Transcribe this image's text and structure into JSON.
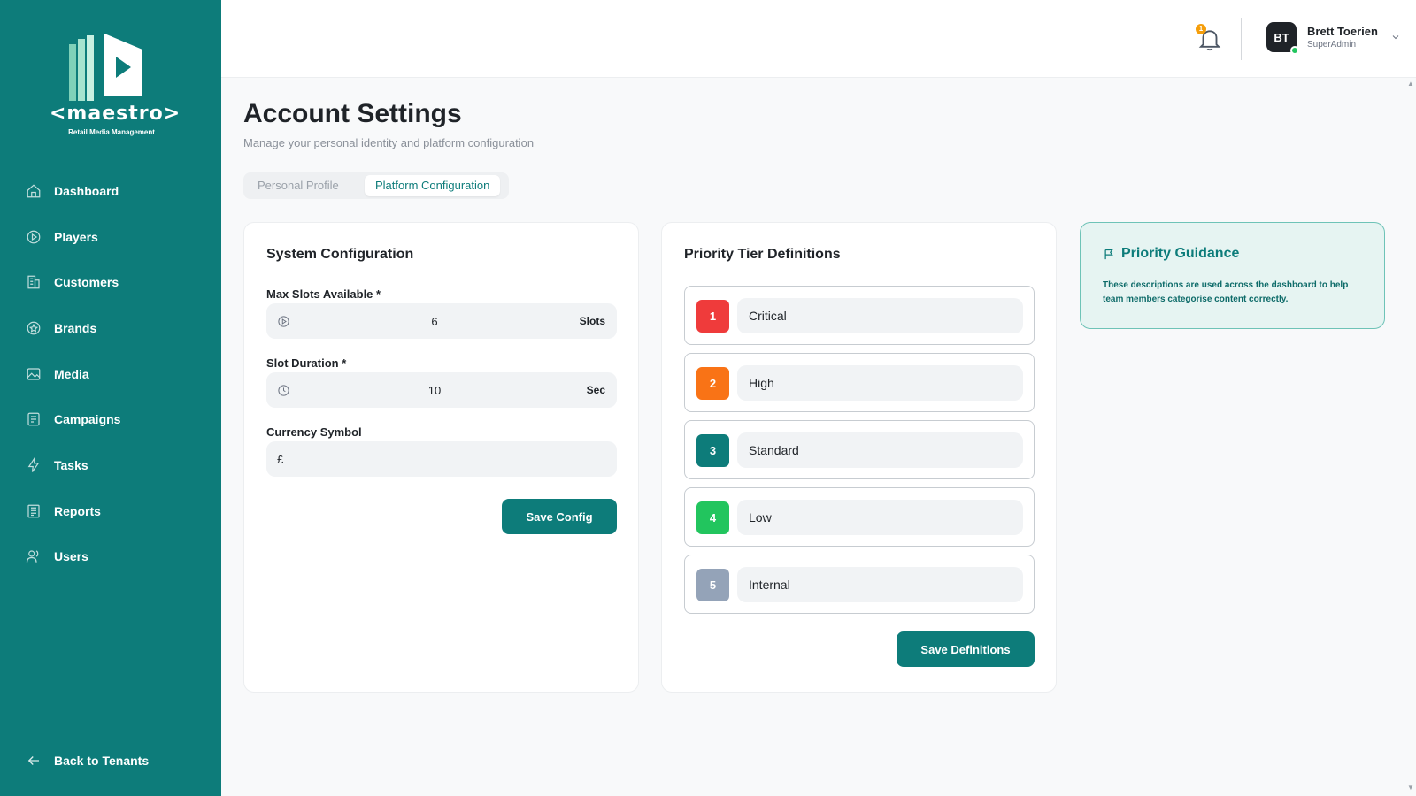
{
  "brand": {
    "name": "<maestro>",
    "tagline": "Retail Media Management",
    "sidebar_color": "#0d7c7a"
  },
  "sidebar": {
    "items": [
      {
        "label": "Dashboard",
        "icon": "home-icon"
      },
      {
        "label": "Players",
        "icon": "play-circle-icon"
      },
      {
        "label": "Customers",
        "icon": "building-icon"
      },
      {
        "label": "Brands",
        "icon": "star-icon"
      },
      {
        "label": "Media",
        "icon": "image-icon"
      },
      {
        "label": "Campaigns",
        "icon": "campaign-icon"
      },
      {
        "label": "Tasks",
        "icon": "lightning-icon"
      },
      {
        "label": "Reports",
        "icon": "report-icon"
      },
      {
        "label": "Users",
        "icon": "users-icon"
      }
    ],
    "back_label": "Back to Tenants"
  },
  "header": {
    "notifications_count": "1",
    "user": {
      "initials": "BT",
      "name": "Brett Toerien",
      "role": "SuperAdmin"
    }
  },
  "page": {
    "title": "Account Settings",
    "subtitle": "Manage your personal identity and platform configuration",
    "tabs": [
      {
        "label": "Personal Profile",
        "active": false
      },
      {
        "label": "Platform Configuration",
        "active": true
      }
    ]
  },
  "system_config": {
    "title": "System Configuration",
    "max_slots": {
      "label": "Max Slots Available *",
      "value": "6",
      "unit": "Slots"
    },
    "slot_duration": {
      "label": "Slot Duration *",
      "value": "10",
      "unit": "Sec"
    },
    "currency": {
      "label": "Currency Symbol",
      "value": "£"
    },
    "save_label": "Save Config"
  },
  "priority_tiers": {
    "title": "Priority Tier Definitions",
    "tiers": [
      {
        "number": "1",
        "name": "Critical",
        "color": "#ef3b3b"
      },
      {
        "number": "2",
        "name": "High",
        "color": "#f97316"
      },
      {
        "number": "3",
        "name": "Standard",
        "color": "#0d7c7a"
      },
      {
        "number": "4",
        "name": "Low",
        "color": "#22c55e"
      },
      {
        "number": "5",
        "name": "Internal",
        "color": "#94a3b8"
      }
    ],
    "save_label": "Save Definitions"
  },
  "guidance": {
    "title": "Priority Guidance",
    "text": "These descriptions are used across the dashboard to help team members categorise content correctly."
  }
}
